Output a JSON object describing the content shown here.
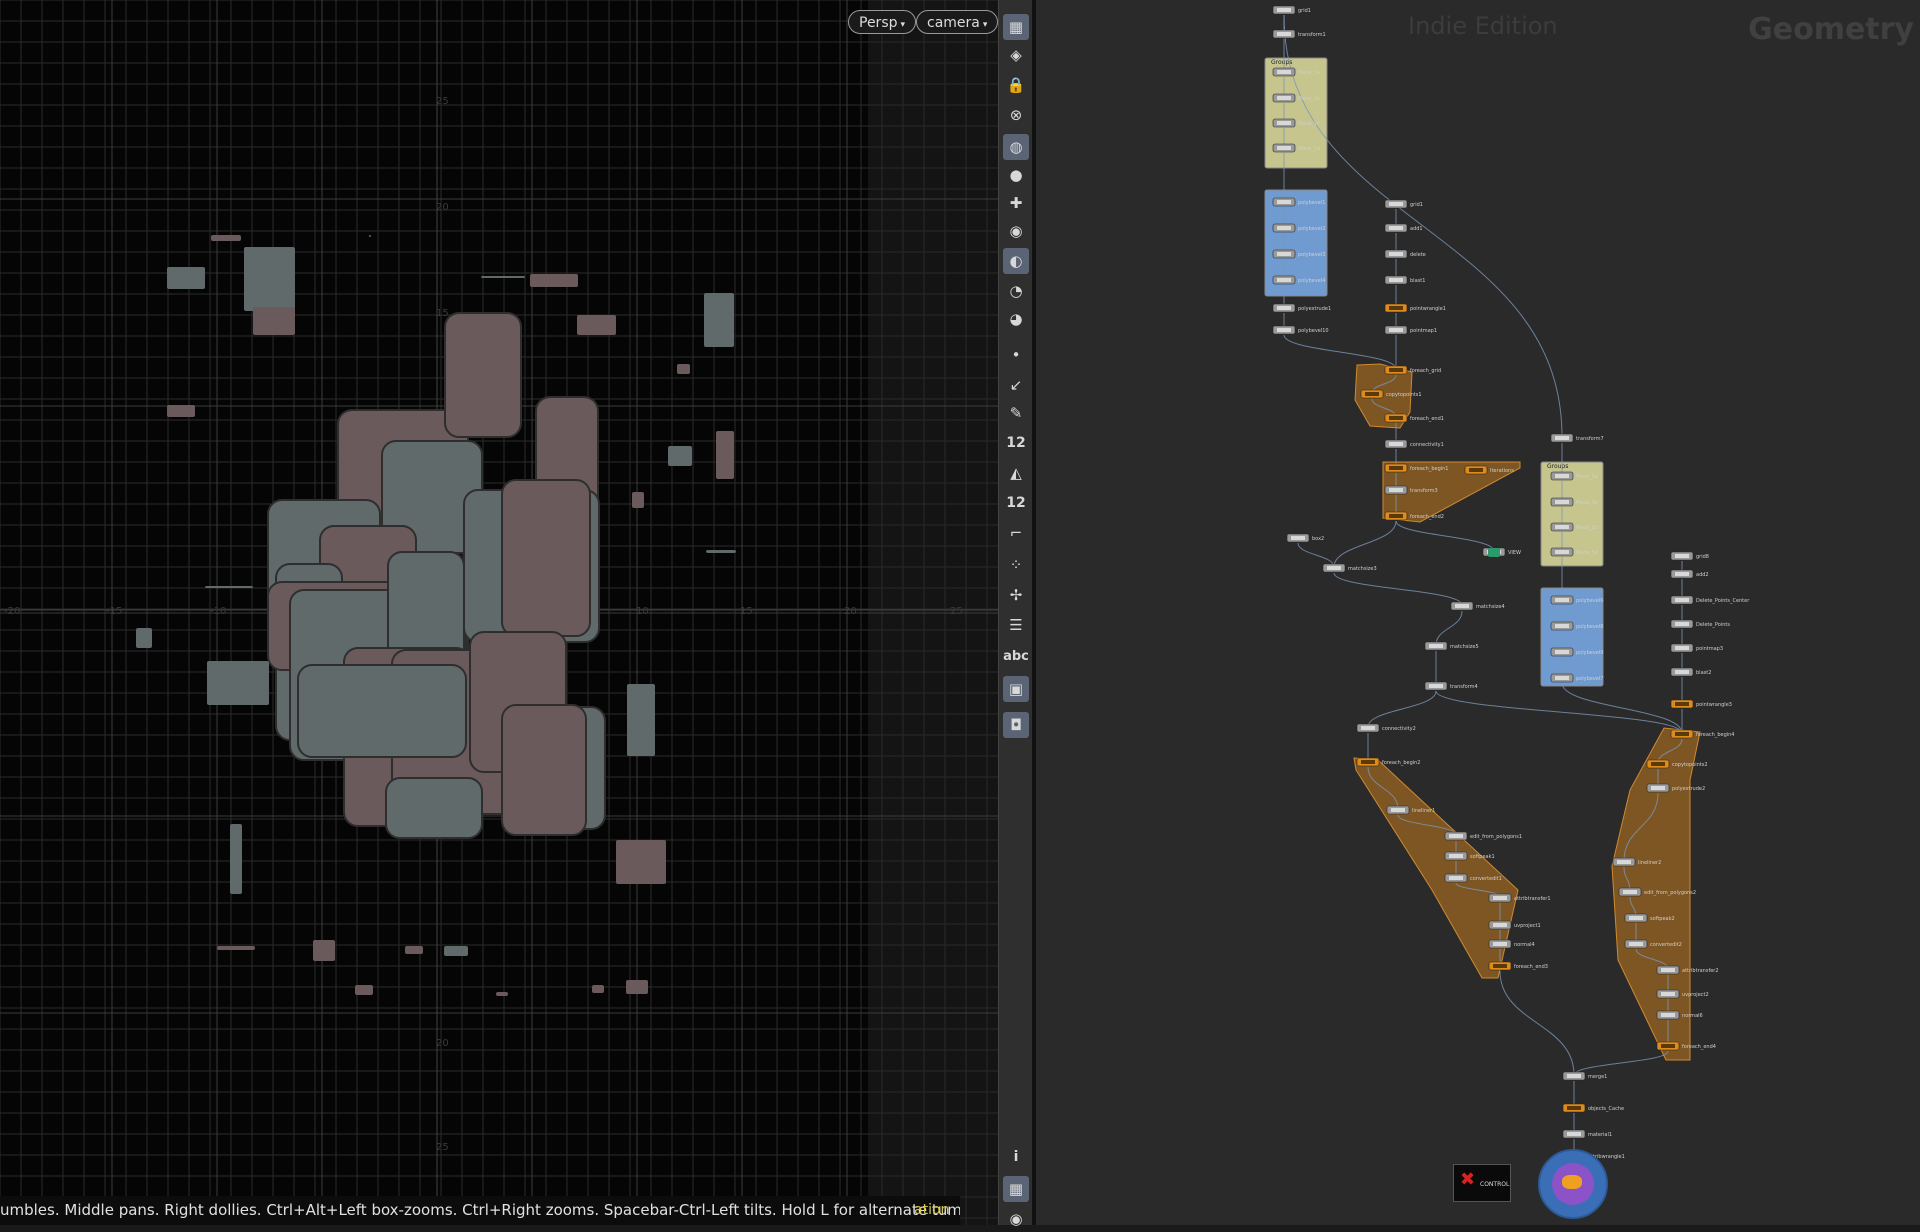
{
  "viewport": {
    "view_menu": "Persp",
    "camera_menu": "camera",
    "status_text": "umbles. Middle pans. Right dollies. Ctrl+Alt+Left box-zooms. Ctrl+Right zooms. Spacebar-Ctrl-Left tilts. Hold L for alternate tumble, dolly, and zoom.",
    "status_tail": "ation",
    "axis_labels": [
      "-20",
      "-15",
      "-10",
      "10",
      "15",
      "20",
      "25",
      "25",
      "20",
      "15",
      "20",
      "25"
    ],
    "colors": {
      "shape_gray": "#606a6a",
      "shape_brown": "#6a5a5c",
      "grid": "#2a2a2a",
      "axis": "#3c3c3c"
    }
  },
  "toolbar": {
    "tools": [
      {
        "icon": "layers-icon"
      },
      {
        "icon": "display-icon"
      },
      {
        "icon": "lock-icon"
      },
      {
        "icon": "close-circle-icon"
      },
      {
        "icon": "info-circle-icon"
      },
      {
        "icon": "light-bulb-icon"
      },
      {
        "icon": "light-add-icon"
      },
      {
        "icon": "light-camera-icon"
      },
      {
        "icon": "sphere-icon"
      },
      {
        "icon": "camera-icon"
      },
      {
        "icon": "camera-add-icon"
      },
      {
        "icon": "dot-icon"
      },
      {
        "icon": "curve-icon"
      },
      {
        "icon": "pen-icon"
      },
      {
        "icon": "brush-12-icon",
        "label": "12"
      },
      {
        "icon": "paint-icon"
      },
      {
        "icon": "paint-12-icon",
        "label": "12"
      },
      {
        "icon": "measure-icon"
      },
      {
        "icon": "snap-icon"
      },
      {
        "icon": "pivot-icon"
      },
      {
        "icon": "stack-icon"
      },
      {
        "icon": "text-icon",
        "label": "abc"
      },
      {
        "icon": "image-icon"
      },
      {
        "icon": "pin-icon"
      },
      {
        "icon": "info-icon",
        "label": "i"
      },
      {
        "icon": "quad-view-icon"
      },
      {
        "icon": "eye-icon"
      }
    ]
  },
  "network": {
    "watermark_edition": "Indie Edition",
    "watermark_context": "Geometry",
    "groups_label": "Groups",
    "control_label": "CONTROL",
    "nodes": [
      {
        "label": "grid1"
      },
      {
        "label": "transform1"
      },
      {
        "label": "Piece_1a"
      },
      {
        "label": "Piece_1b"
      },
      {
        "label": "Piece_1c"
      },
      {
        "label": "Piece_1d"
      },
      {
        "label": "polybevel1"
      },
      {
        "label": "polybevel2"
      },
      {
        "label": "polybevel3"
      },
      {
        "label": "polybevel4"
      },
      {
        "label": "polyextrude1"
      },
      {
        "label": "polybevel10"
      },
      {
        "label": "grid1"
      },
      {
        "label": "add1"
      },
      {
        "label": "delete"
      },
      {
        "label": "blast1"
      },
      {
        "label": "pointwrangle1"
      },
      {
        "label": "pointmap1"
      },
      {
        "label": "foreach_grid"
      },
      {
        "label": "copytopoints1"
      },
      {
        "label": "foreach_end1"
      },
      {
        "label": "connectivity1"
      },
      {
        "label": "foreach_begin1"
      },
      {
        "label": "Iterations"
      },
      {
        "label": "transform3"
      },
      {
        "label": "foreach_end2"
      },
      {
        "label": "VIEW"
      },
      {
        "label": "box2"
      },
      {
        "label": "matchsize3"
      },
      {
        "label": "matchsize4"
      },
      {
        "label": "matchsize5"
      },
      {
        "label": "transform4"
      },
      {
        "label": "transform7"
      },
      {
        "label": "Piece_5a"
      },
      {
        "label": "Piece_5b"
      },
      {
        "label": "Piece_5c"
      },
      {
        "label": "Piece_5d"
      },
      {
        "label": "polybevel6"
      },
      {
        "label": "polybevel8"
      },
      {
        "label": "polybevel9"
      },
      {
        "label": "polybevel7"
      },
      {
        "label": "grid8"
      },
      {
        "label": "add2"
      },
      {
        "label": "Delete_Points_Center"
      },
      {
        "label": "Delete_Points"
      },
      {
        "label": "pointmap3"
      },
      {
        "label": "blast2"
      },
      {
        "label": "pointwrangle3"
      },
      {
        "label": "foreach_begin4"
      },
      {
        "label": "copytopoints2"
      },
      {
        "label": "polyextrude2"
      },
      {
        "label": "connectivity2"
      },
      {
        "label": "foreach_begin2"
      },
      {
        "label": "lineliner1"
      },
      {
        "label": "edit_from_polygons1"
      },
      {
        "label": "softpeak1"
      },
      {
        "label": "convertedit1"
      },
      {
        "label": "attribtransfer1"
      },
      {
        "label": "uvproject1"
      },
      {
        "label": "normal4"
      },
      {
        "label": "foreach_end3"
      },
      {
        "label": "lineliner2"
      },
      {
        "label": "edit_from_polygons2"
      },
      {
        "label": "softpeak2"
      },
      {
        "label": "convertedit2"
      },
      {
        "label": "attribtransfer2"
      },
      {
        "label": "uvproject2"
      },
      {
        "label": "normal6"
      },
      {
        "label": "foreach_end4"
      },
      {
        "label": "merge1"
      },
      {
        "label": "objects_Cache"
      },
      {
        "label": "material1"
      },
      {
        "label": "attribwrangle1"
      }
    ],
    "colors": {
      "background": "#2a2a2a",
      "wire": "#7d96b8",
      "groups_yellow": "#c6c58e",
      "groups_blue": "#6f9bd1",
      "loop_orange": "#c27a1e",
      "node_orange": "#e08a1a"
    }
  }
}
